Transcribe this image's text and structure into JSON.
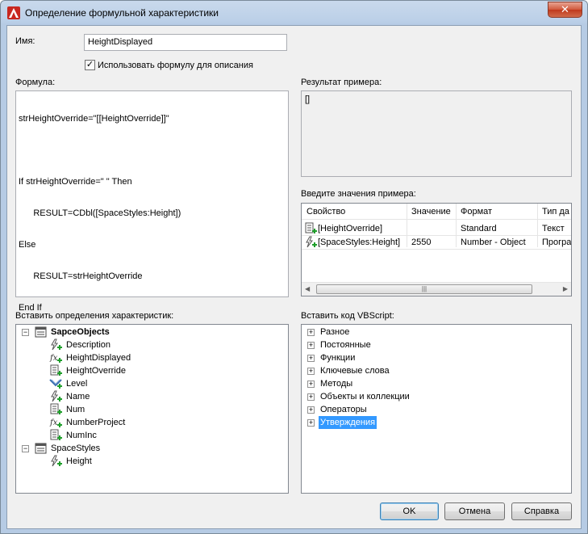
{
  "window": {
    "title": "Определение формульной характеристики",
    "close_label": "✕"
  },
  "name_field": {
    "label": "Имя:",
    "value": "HeightDisplayed"
  },
  "use_formula": {
    "label": "Использовать формулу для описания",
    "checked": true,
    "mark": "✓"
  },
  "formula": {
    "label": "Формула:",
    "lines": [
      "strHeightOverride=\"[[HeightOverride]]\"",
      "",
      "If strHeightOverride=\" \" Then",
      "      RESULT=CDbl([SpaceStyles:Height])",
      "Else",
      "      RESULT=strHeightOverride",
      "End If"
    ]
  },
  "result": {
    "label": "Результат примера:",
    "value": "[]"
  },
  "sample_values": {
    "label": "Введите значения примера:",
    "columns": [
      "Свойство",
      "Значение",
      "Формат",
      "Тип да"
    ],
    "rows": [
      {
        "property": "[HeightOverride]",
        "value": "",
        "format": "Standard",
        "type": "Текст",
        "icon": "manual-property-icon"
      },
      {
        "property": "[SpaceStyles:Height]",
        "value": "2550",
        "format": "Number - Object",
        "type": "Програ",
        "icon": "automatic-property-icon"
      }
    ],
    "scroll_grip": "|||"
  },
  "insert_properties": {
    "label": "Вставить определения характеристик:",
    "groups": [
      {
        "name": "SapceObjects",
        "expander": "−",
        "items": [
          {
            "label": "Description",
            "icon": "automatic-property-icon"
          },
          {
            "label": "HeightDisplayed",
            "icon": "formula-property-icon"
          },
          {
            "label": "HeightOverride",
            "icon": "manual-property-icon"
          },
          {
            "label": "Level",
            "icon": "level-property-icon"
          },
          {
            "label": "Name",
            "icon": "automatic-property-icon"
          },
          {
            "label": "Num",
            "icon": "manual-property-icon"
          },
          {
            "label": "NumberProject",
            "icon": "formula-property-icon"
          },
          {
            "label": "NumInc",
            "icon": "manual-property-icon"
          }
        ]
      },
      {
        "name": "SpaceStyles",
        "expander": "−",
        "items": [
          {
            "label": "Height",
            "icon": "automatic-property-icon"
          }
        ]
      }
    ]
  },
  "insert_vbscript": {
    "label": "Вставить код VBScript:",
    "items": [
      "Разное",
      "Постоянные",
      "Функции",
      "Ключевые слова",
      "Методы",
      "Объекты и коллекции",
      "Операторы",
      "Утверждения"
    ],
    "expander": "+",
    "selected_index": 7
  },
  "buttons": {
    "ok": "OK",
    "cancel": "Отмена",
    "help": "Справка"
  },
  "colors": {
    "selection": "#3399ff",
    "title_bar": "#bcd0e8",
    "close_button": "#c0391c",
    "dialog_bg": "#f0f0f0"
  }
}
